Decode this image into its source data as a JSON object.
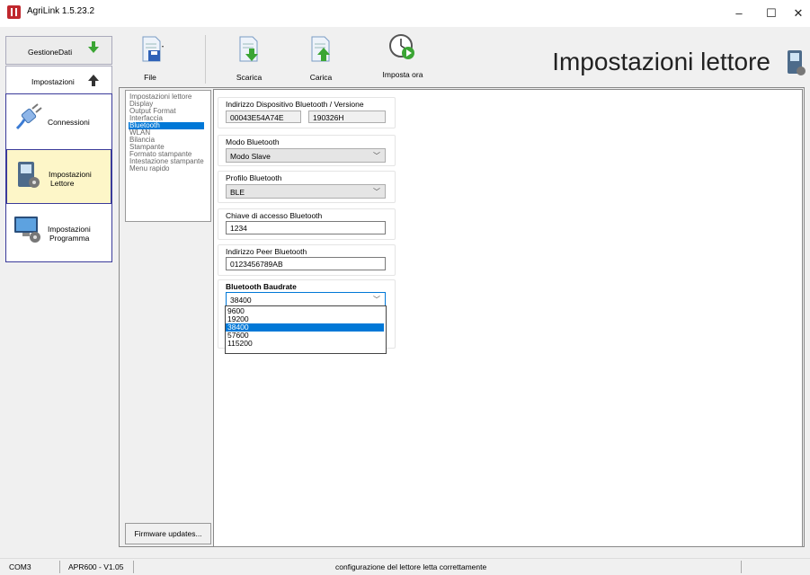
{
  "window": {
    "title": "AgriLink 1.5.23.2",
    "minimize": "–",
    "maximize": "☐",
    "close": "✕"
  },
  "nav": {
    "tabs": [
      {
        "label": "GestioneDati"
      },
      {
        "label": "Impostazioni"
      }
    ],
    "cards": [
      {
        "label": "Connessioni",
        "icon": "plug-icon"
      },
      {
        "label_line1": "Impostazioni",
        "label_line2": "Lettore",
        "icon": "reader-settings-icon"
      },
      {
        "label_line1": "Impostazioni",
        "label_line2": "Programma",
        "icon": "computer-settings-icon"
      }
    ]
  },
  "toolbar": {
    "file": "File",
    "scarica": "Scarica",
    "carica": "Carica",
    "imposta_ora": "Imposta ora",
    "page_title": "Impostazioni lettore"
  },
  "categories": [
    "Impostazioni lettore",
    "Display",
    "Output Format",
    "Interfaccia",
    "Bluetooth",
    "WLAN",
    "Bilancia",
    "Stampante",
    "Formato stampante",
    "Intestazione stampante",
    "Menu rapido"
  ],
  "selected_category": "Bluetooth",
  "firmware_button": "Firmware updates...",
  "bluetooth": {
    "address_group": "Indirizzo Dispositivo Bluetooth / Versione",
    "address": "00043E54A74E",
    "version": "190326H",
    "mode_group": "Modo Bluetooth",
    "mode": "Modo Slave",
    "profile_group": "Profilo Bluetooth",
    "profile": "BLE",
    "key_group": "Chiave di accesso Bluetooth",
    "key": "1234",
    "peer_group": "Indirizzo Peer Bluetooth",
    "peer": "0123456789AB",
    "baud_group": "Bluetooth Baudrate",
    "baud": "38400",
    "baud_options": [
      "9600",
      "19200",
      "38400",
      "57600",
      "115200"
    ]
  },
  "status": {
    "port": "COM3",
    "device": "APR600 - V1.05",
    "message": "configurazione del lettore letta correttamente"
  },
  "colors": {
    "accent": "#0078d7",
    "selected_card": "#fdf6c8",
    "nav_border": "#3a3a9a"
  }
}
